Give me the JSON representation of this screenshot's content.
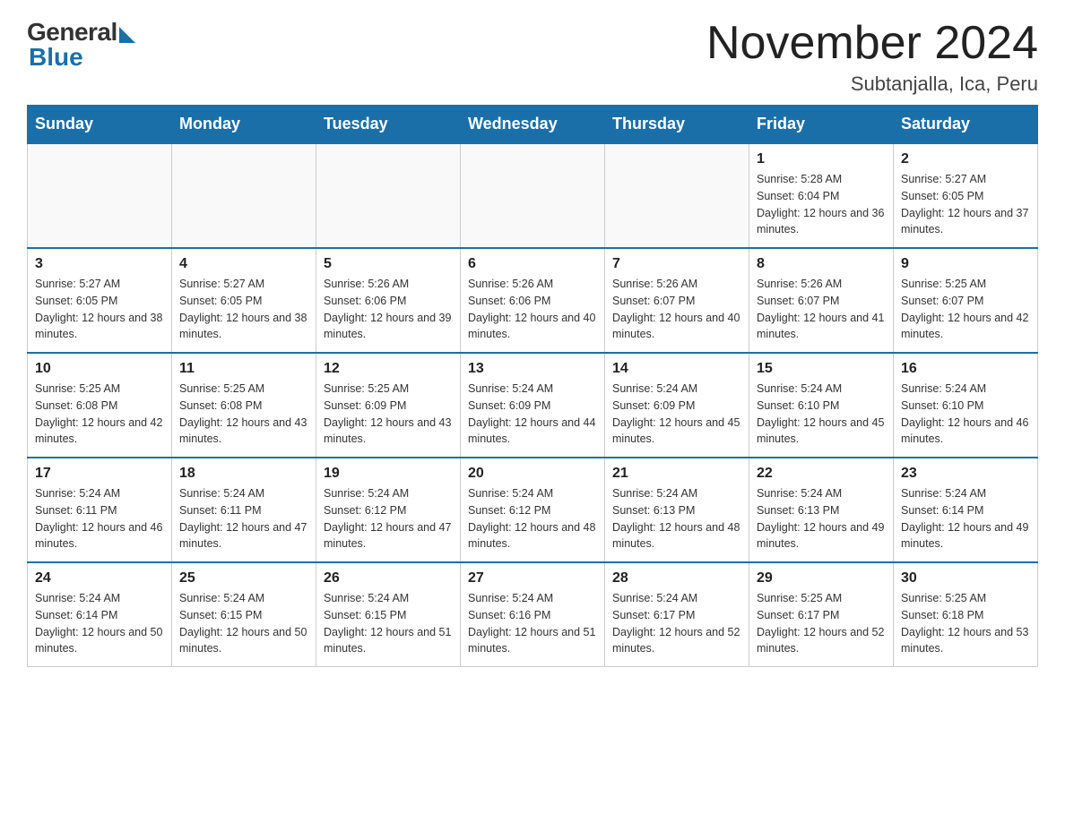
{
  "logo": {
    "general": "General",
    "blue": "Blue"
  },
  "header": {
    "title": "November 2024",
    "subtitle": "Subtanjalla, Ica, Peru"
  },
  "weekdays": [
    "Sunday",
    "Monday",
    "Tuesday",
    "Wednesday",
    "Thursday",
    "Friday",
    "Saturday"
  ],
  "weeks": [
    [
      {
        "day": "",
        "info": ""
      },
      {
        "day": "",
        "info": ""
      },
      {
        "day": "",
        "info": ""
      },
      {
        "day": "",
        "info": ""
      },
      {
        "day": "",
        "info": ""
      },
      {
        "day": "1",
        "info": "Sunrise: 5:28 AM\nSunset: 6:04 PM\nDaylight: 12 hours and 36 minutes."
      },
      {
        "day": "2",
        "info": "Sunrise: 5:27 AM\nSunset: 6:05 PM\nDaylight: 12 hours and 37 minutes."
      }
    ],
    [
      {
        "day": "3",
        "info": "Sunrise: 5:27 AM\nSunset: 6:05 PM\nDaylight: 12 hours and 38 minutes."
      },
      {
        "day": "4",
        "info": "Sunrise: 5:27 AM\nSunset: 6:05 PM\nDaylight: 12 hours and 38 minutes."
      },
      {
        "day": "5",
        "info": "Sunrise: 5:26 AM\nSunset: 6:06 PM\nDaylight: 12 hours and 39 minutes."
      },
      {
        "day": "6",
        "info": "Sunrise: 5:26 AM\nSunset: 6:06 PM\nDaylight: 12 hours and 40 minutes."
      },
      {
        "day": "7",
        "info": "Sunrise: 5:26 AM\nSunset: 6:07 PM\nDaylight: 12 hours and 40 minutes."
      },
      {
        "day": "8",
        "info": "Sunrise: 5:26 AM\nSunset: 6:07 PM\nDaylight: 12 hours and 41 minutes."
      },
      {
        "day": "9",
        "info": "Sunrise: 5:25 AM\nSunset: 6:07 PM\nDaylight: 12 hours and 42 minutes."
      }
    ],
    [
      {
        "day": "10",
        "info": "Sunrise: 5:25 AM\nSunset: 6:08 PM\nDaylight: 12 hours and 42 minutes."
      },
      {
        "day": "11",
        "info": "Sunrise: 5:25 AM\nSunset: 6:08 PM\nDaylight: 12 hours and 43 minutes."
      },
      {
        "day": "12",
        "info": "Sunrise: 5:25 AM\nSunset: 6:09 PM\nDaylight: 12 hours and 43 minutes."
      },
      {
        "day": "13",
        "info": "Sunrise: 5:24 AM\nSunset: 6:09 PM\nDaylight: 12 hours and 44 minutes."
      },
      {
        "day": "14",
        "info": "Sunrise: 5:24 AM\nSunset: 6:09 PM\nDaylight: 12 hours and 45 minutes."
      },
      {
        "day": "15",
        "info": "Sunrise: 5:24 AM\nSunset: 6:10 PM\nDaylight: 12 hours and 45 minutes."
      },
      {
        "day": "16",
        "info": "Sunrise: 5:24 AM\nSunset: 6:10 PM\nDaylight: 12 hours and 46 minutes."
      }
    ],
    [
      {
        "day": "17",
        "info": "Sunrise: 5:24 AM\nSunset: 6:11 PM\nDaylight: 12 hours and 46 minutes."
      },
      {
        "day": "18",
        "info": "Sunrise: 5:24 AM\nSunset: 6:11 PM\nDaylight: 12 hours and 47 minutes."
      },
      {
        "day": "19",
        "info": "Sunrise: 5:24 AM\nSunset: 6:12 PM\nDaylight: 12 hours and 47 minutes."
      },
      {
        "day": "20",
        "info": "Sunrise: 5:24 AM\nSunset: 6:12 PM\nDaylight: 12 hours and 48 minutes."
      },
      {
        "day": "21",
        "info": "Sunrise: 5:24 AM\nSunset: 6:13 PM\nDaylight: 12 hours and 48 minutes."
      },
      {
        "day": "22",
        "info": "Sunrise: 5:24 AM\nSunset: 6:13 PM\nDaylight: 12 hours and 49 minutes."
      },
      {
        "day": "23",
        "info": "Sunrise: 5:24 AM\nSunset: 6:14 PM\nDaylight: 12 hours and 49 minutes."
      }
    ],
    [
      {
        "day": "24",
        "info": "Sunrise: 5:24 AM\nSunset: 6:14 PM\nDaylight: 12 hours and 50 minutes."
      },
      {
        "day": "25",
        "info": "Sunrise: 5:24 AM\nSunset: 6:15 PM\nDaylight: 12 hours and 50 minutes."
      },
      {
        "day": "26",
        "info": "Sunrise: 5:24 AM\nSunset: 6:15 PM\nDaylight: 12 hours and 51 minutes."
      },
      {
        "day": "27",
        "info": "Sunrise: 5:24 AM\nSunset: 6:16 PM\nDaylight: 12 hours and 51 minutes."
      },
      {
        "day": "28",
        "info": "Sunrise: 5:24 AM\nSunset: 6:17 PM\nDaylight: 12 hours and 52 minutes."
      },
      {
        "day": "29",
        "info": "Sunrise: 5:25 AM\nSunset: 6:17 PM\nDaylight: 12 hours and 52 minutes."
      },
      {
        "day": "30",
        "info": "Sunrise: 5:25 AM\nSunset: 6:18 PM\nDaylight: 12 hours and 53 minutes."
      }
    ]
  ]
}
